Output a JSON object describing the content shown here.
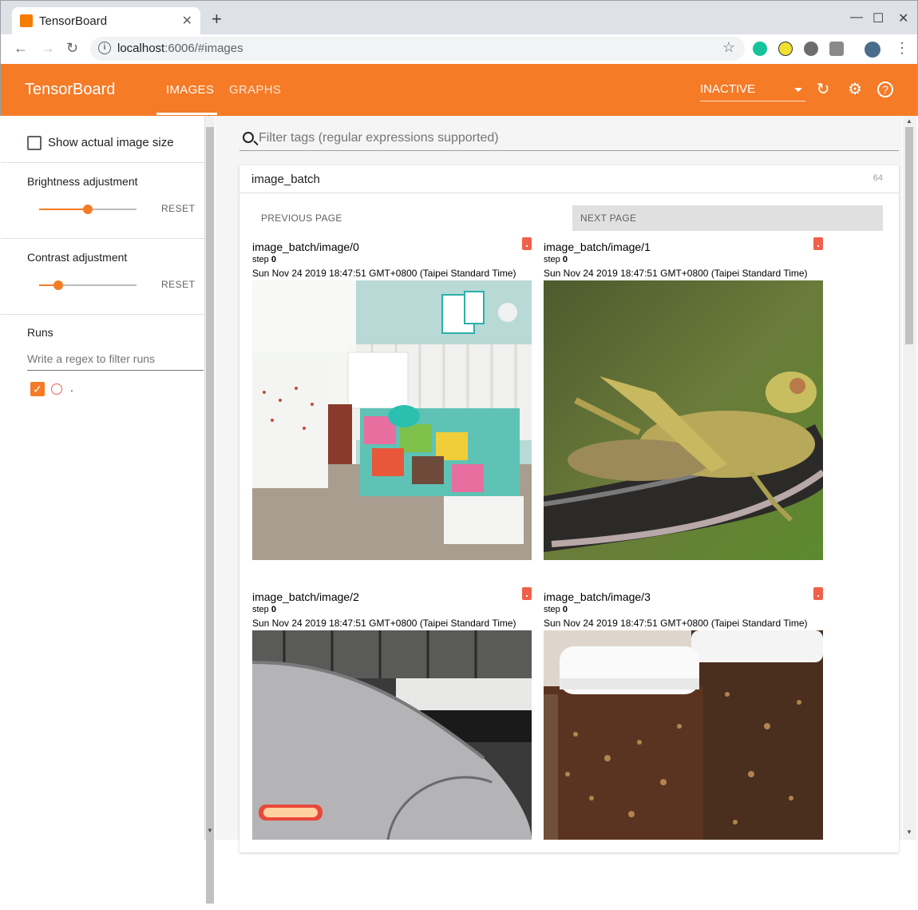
{
  "browser": {
    "tab_title": "TensorBoard",
    "url_host": "localhost",
    "url_rest": ":6006/#images"
  },
  "header": {
    "brand": "TensorBoard",
    "tabs": [
      {
        "label": "IMAGES",
        "active": true
      },
      {
        "label": "GRAPHS",
        "active": false
      }
    ],
    "run_select": "INACTIVE"
  },
  "sidebar": {
    "show_actual_size_label": "Show actual image size",
    "brightness": {
      "label": "Brightness adjustment",
      "value": 0.5,
      "reset": "RESET"
    },
    "contrast": {
      "label": "Contrast adjustment",
      "value": 0.2,
      "reset": "RESET"
    },
    "runs": {
      "label": "Runs",
      "filter_placeholder": "Write a regex to filter runs",
      "items": [
        {
          "name": ".",
          "checked": true
        }
      ]
    }
  },
  "main": {
    "filter_placeholder": "Filter tags (regular expressions supported)",
    "group": {
      "tag": "image_batch",
      "count": "64"
    },
    "prev_page": "PREVIOUS PAGE",
    "next_page": "NEXT PAGE",
    "images": [
      {
        "name": "image_batch/image/0",
        "step_label": "step",
        "step": "0",
        "time": "Sun Nov 24 2019 18:47:51 GMT+0800 (Taipei Standard Time)"
      },
      {
        "name": "image_batch/image/1",
        "step_label": "step",
        "step": "0",
        "time": "Sun Nov 24 2019 18:47:51 GMT+0800 (Taipei Standard Time)"
      },
      {
        "name": "image_batch/image/2",
        "step_label": "step",
        "step": "0",
        "time": "Sun Nov 24 2019 18:47:51 GMT+0800 (Taipei Standard Time)"
      },
      {
        "name": "image_batch/image/3",
        "step_label": "step",
        "step": "0",
        "time": "Sun Nov 24 2019 18:47:51 GMT+0800 (Taipei Standard Time)"
      }
    ]
  },
  "colors": {
    "accent": "#f57b27"
  }
}
